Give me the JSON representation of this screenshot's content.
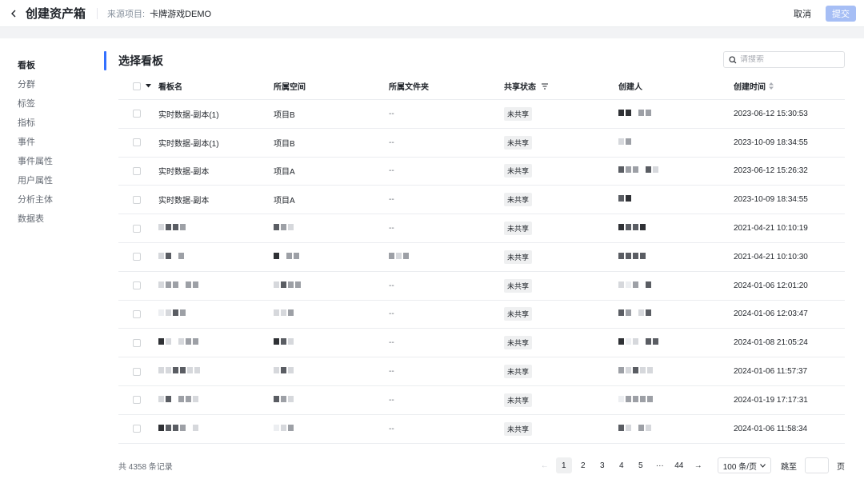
{
  "header": {
    "title": "创建资产箱",
    "source_label": "来源项目:",
    "source_value": "卡牌游戏DEMO",
    "cancel_label": "取消",
    "submit_label": "提交"
  },
  "sidebar": {
    "items": [
      {
        "label": "看板",
        "active": true
      },
      {
        "label": "分群"
      },
      {
        "label": "标签"
      },
      {
        "label": "指标"
      },
      {
        "label": "事件"
      },
      {
        "label": "事件属性"
      },
      {
        "label": "用户属性"
      },
      {
        "label": "分析主体"
      },
      {
        "label": "数据表"
      }
    ]
  },
  "section": {
    "title": "选择看板",
    "search_placeholder": "请搜索"
  },
  "table": {
    "columns": [
      "看板名",
      "所属空间",
      "所属文件夹",
      "共享状态",
      "创建人",
      "创建时间"
    ],
    "rows": [
      {
        "name": "实时数据-副本(1)",
        "space": "项目B",
        "folder": "--",
        "share": "未共享",
        "time": "2023-06-12 15:30:53"
      },
      {
        "name": "实时数据-副本(1)",
        "space": "项目B",
        "folder": "--",
        "share": "未共享",
        "time": "2023-10-09 18:34:55"
      },
      {
        "name": "实时数据-副本",
        "space": "项目A",
        "folder": "--",
        "share": "未共享",
        "time": "2023-06-12 15:26:32"
      },
      {
        "name": "实时数据-副本",
        "space": "项目A",
        "folder": "--",
        "share": "未共享",
        "time": "2023-10-09 18:34:55"
      },
      {
        "name": "",
        "space": "",
        "folder": "--",
        "share": "未共享",
        "time": "2021-04-21 10:10:19"
      },
      {
        "name": "",
        "space": "",
        "folder": "",
        "share": "未共享",
        "time": "2021-04-21 10:10:30"
      },
      {
        "name": "",
        "space": "",
        "folder": "--",
        "share": "未共享",
        "time": "2024-01-06 12:01:20"
      },
      {
        "name": "",
        "space": "",
        "folder": "--",
        "share": "未共享",
        "time": "2024-01-06 12:03:47"
      },
      {
        "name": "",
        "space": "",
        "folder": "--",
        "share": "未共享",
        "time": "2024-01-08 21:05:24"
      },
      {
        "name": "",
        "space": "",
        "folder": "--",
        "share": "未共享",
        "time": "2024-01-06 11:57:37"
      },
      {
        "name": "",
        "space": "",
        "folder": "--",
        "share": "未共享",
        "time": "2024-01-19 17:17:31"
      },
      {
        "name": "",
        "space": "",
        "folder": "--",
        "share": "未共享",
        "time": "2024-01-06 11:58:34"
      }
    ]
  },
  "pagination": {
    "total": "共 4358 条记录",
    "pages": [
      "1",
      "2",
      "3",
      "4",
      "5",
      "···",
      "44"
    ],
    "current": "1",
    "page_size": "100 条/页",
    "jump_label": "跳至",
    "jump_suffix": "页"
  },
  "colors": {
    "accent": "#3370ff",
    "submit_disabled": "#a6bef5",
    "badge_bg": "#eff0f1"
  }
}
